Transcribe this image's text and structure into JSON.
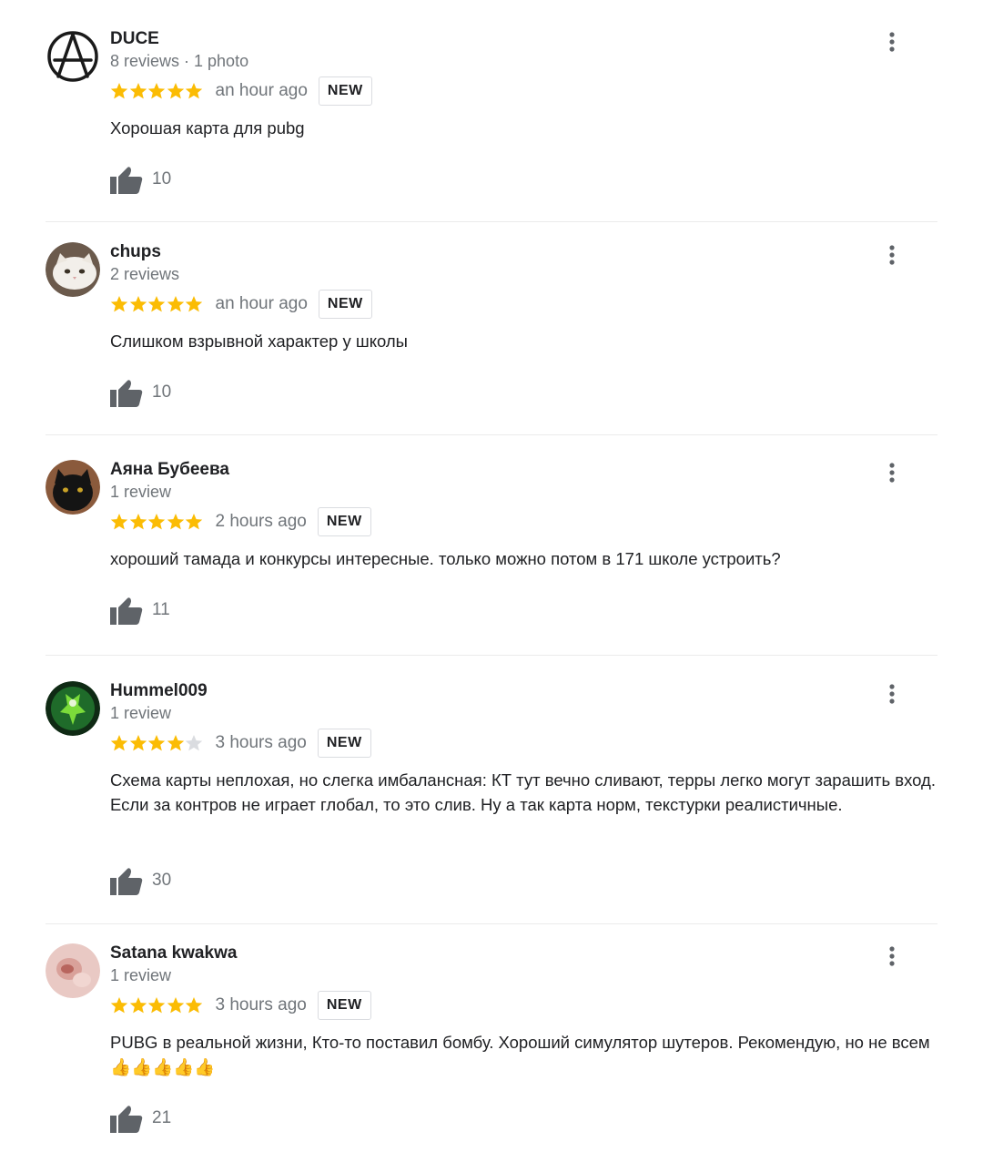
{
  "colors": {
    "star_filled": "#fbbc04",
    "star_empty": "#dadce0",
    "meta_text": "#70757a",
    "divider": "#ebebeb"
  },
  "reviews": [
    {
      "author": "DUCE",
      "meta": "8 reviews · 1 photo",
      "rating": 5,
      "time": "an hour ago",
      "badge": "NEW",
      "text": "Хорошая карта для pubg",
      "likes": "10",
      "avatar_icon": "anarchy-symbol-icon"
    },
    {
      "author": "chups",
      "meta": "2 reviews",
      "rating": 5,
      "time": "an hour ago",
      "badge": "NEW",
      "text": "Слишком взрывной характер у школы",
      "likes": "10",
      "avatar_icon": "white-cat-icon"
    },
    {
      "author": "Аяна Бубеева",
      "meta": "1 review",
      "rating": 5,
      "time": "2 hours ago",
      "badge": "NEW",
      "text": "хороший тамада и конкурсы интересные. только можно потом в 171 школе устроить?",
      "likes": "11",
      "avatar_icon": "black-cat-icon"
    },
    {
      "author": "Hummel009",
      "meta": "1 review",
      "rating": 4,
      "time": "3 hours ago",
      "badge": "NEW",
      "text": "Схема карты неплохая, но слегка имбалансная: КТ тут вечно сливают, терры легко могут зарашить вход. Если за контров не играет глобал, то это слив. Ну а так карта норм, текстурки реалистичные.",
      "likes": "30",
      "avatar_icon": "green-character-icon"
    },
    {
      "author": "Satana kwakwa",
      "meta": "1 review",
      "rating": 5,
      "time": "3 hours ago",
      "badge": "NEW",
      "text": "PUBG в реальной жизни, Кто-то поставил бомбу. Хороший симулятор шутеров. Рекомендую, но не всем👍👍👍👍👍",
      "likes": "21",
      "avatar_icon": "pink-face-icon"
    }
  ]
}
